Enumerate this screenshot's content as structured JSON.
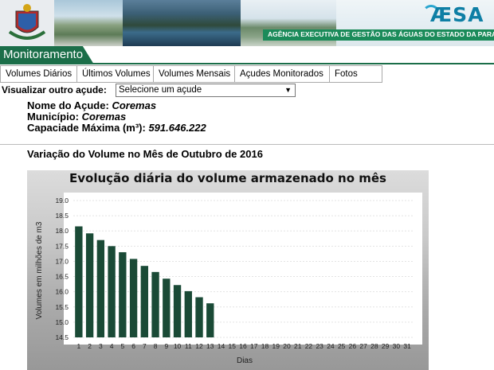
{
  "banner": {
    "logo_text": "ÆSA",
    "agency": "AGÊNCIA EXECUTIVA DE GESTÃO DAS ÁGUAS DO ESTADO DA PARAÍBA"
  },
  "section_title": "Monitoramento",
  "menu": [
    {
      "label": "Volumes Diários"
    },
    {
      "label": "Últimos Volumes"
    },
    {
      "label": "Volumes Mensais"
    },
    {
      "label": "Açudes Monitorados"
    },
    {
      "label": "Fotos"
    }
  ],
  "selector": {
    "label": "Visualizar outro açude:",
    "value": "Selecione um açude"
  },
  "info": {
    "nome_label": "Nome do Açude:",
    "nome_value": "Coremas",
    "municipio_label": "Município:",
    "municipio_value": "Coremas",
    "capacidade_label": "Capaciade Máxima (m³):",
    "capacidade_value": "591.646.222"
  },
  "subtitle": "Variação do Volume no Mês de Outubro de 2016",
  "colors": {
    "bar": "#1a4a36",
    "green": "#1b6e49"
  },
  "chart_data": {
    "type": "bar",
    "title": "Evolução diária do volume armazenado no mês",
    "xlabel": "Dias",
    "ylabel": "Volumes em milhões de m3",
    "ylim": [
      14.5,
      19.0
    ],
    "yticks": [
      "19.0",
      "18.5",
      "18.0",
      "17.5",
      "17.0",
      "16.5",
      "16.0",
      "15.5",
      "15.0",
      "14.5"
    ],
    "categories": [
      "1",
      "2",
      "3",
      "4",
      "5",
      "6",
      "7",
      "8",
      "9",
      "10",
      "11",
      "12",
      "13",
      "14",
      "15",
      "16",
      "17",
      "18",
      "19",
      "20",
      "21",
      "22",
      "23",
      "24",
      "25",
      "26",
      "27",
      "28",
      "29",
      "30",
      "31"
    ],
    "values": [
      18.15,
      17.92,
      17.7,
      17.5,
      17.3,
      17.08,
      16.85,
      16.65,
      16.43,
      16.22,
      16.02,
      15.82,
      15.62
    ],
    "grid": true
  }
}
